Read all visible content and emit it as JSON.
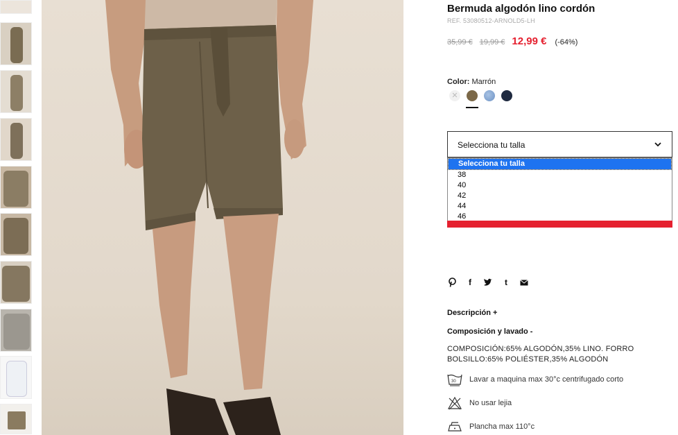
{
  "product": {
    "title": "Bermuda algodón lino cordón",
    "ref": "REF. 53080512-ARNOLD5-LH",
    "original_price": "35,99 €",
    "previous_price": "19,99 €",
    "sale_price": "12,99 €",
    "discount": "(-64%)"
  },
  "color": {
    "label": "Color:",
    "selected": "Marrón",
    "swatches": [
      {
        "name": "unavailable",
        "hex": "#f1f1f1"
      },
      {
        "name": "marron",
        "hex": "#7b6848"
      },
      {
        "name": "light-blue",
        "hex": "#7fa3d0"
      },
      {
        "name": "navy",
        "hex": "#1f2a40"
      }
    ]
  },
  "size": {
    "placeholder": "Selecciona tu talla",
    "options": [
      "Selecciona tu talla",
      "38",
      "40",
      "42",
      "44",
      "46"
    ]
  },
  "share": {
    "icons": [
      "pinterest-icon",
      "facebook-icon",
      "twitter-icon",
      "tumblr-icon",
      "email-icon"
    ],
    "glyphs": [
      "℗",
      "f",
      "t",
      "t",
      "✉"
    ]
  },
  "sections": {
    "description": "Descripción +",
    "composition": "Composición y lavado -",
    "composition_text": "COMPOSICIÓN:65% ALGODÓN,35% LINO. FORRO BOLSILLO:65% POLIÉSTER,35% ALGODÓN"
  },
  "care": [
    {
      "icon": "wash-30-icon",
      "text": "Lavar a maquina max 30°c centrifugado corto"
    },
    {
      "icon": "no-bleach-icon",
      "text": "No usar lejia"
    },
    {
      "icon": "iron-icon",
      "text": "Plancha max 110°c"
    }
  ],
  "colors": {
    "sale_red": "#e5202f",
    "highlight_blue": "#1e73f0",
    "shorts": "#6d6049"
  }
}
